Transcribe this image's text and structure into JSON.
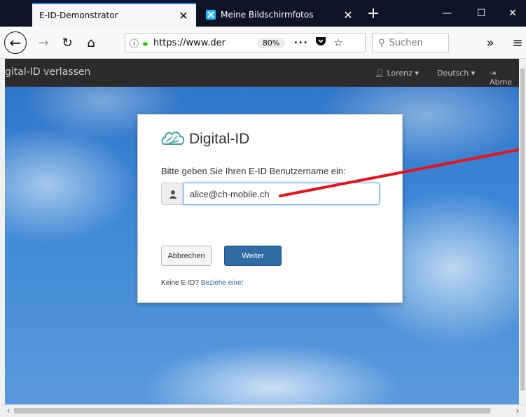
{
  "tabs": [
    {
      "title": "E-ID-Demonstrator",
      "active": true
    },
    {
      "title": "Meine Bildschirmfotos",
      "active": false
    }
  ],
  "toolbar": {
    "url": "https://www.der",
    "zoom": "80%",
    "search_placeholder": "Suchen",
    "overflow_label": "»",
    "menu_label": "≡",
    "more_label": "•••"
  },
  "appbar": {
    "brand": "gital-ID verlassen",
    "user_menu": "Lorenz",
    "language_menu": "Deutsch",
    "logout": "Abme"
  },
  "login_card": {
    "logo_text": "Digital-ID",
    "prompt": "Bitte geben Sie Ihren E-ID Benutzername ein:",
    "username_value": "alice@ch-mobile.ch",
    "cancel_label": "Abbrechen",
    "next_label": "Weiter",
    "no_id_text": "Keine E-ID?",
    "get_one_link": "Beziehe eine!"
  },
  "colors": {
    "tabstrip": "#0e1426",
    "accent": "#0a84ff",
    "next_button": "#2f6aa6",
    "annotation_arrow": "#e8141b",
    "link": "#2a6ab0"
  }
}
